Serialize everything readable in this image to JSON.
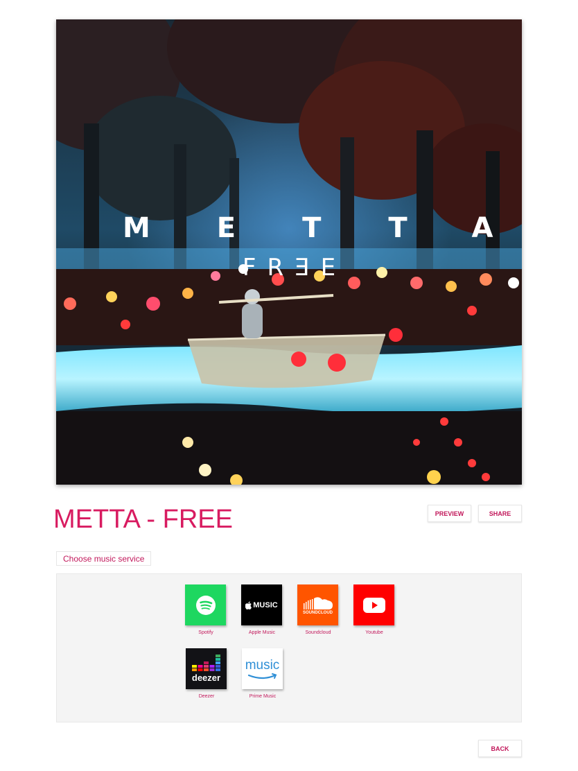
{
  "cover": {
    "artist_text": "METTA",
    "track_text": "FRƎE"
  },
  "track": {
    "title": "METTA - FREE"
  },
  "actions": {
    "preview_label": "PREVIEW",
    "share_label": "SHARE",
    "back_label": "BACK"
  },
  "services": {
    "heading": "Choose music service",
    "items": [
      {
        "name": "Spotify",
        "icon": "spotify-icon",
        "color": "#1ed760"
      },
      {
        "name": "Apple Music",
        "icon": "apple-music-icon",
        "color": "#000000",
        "tile_text": "MUSIC"
      },
      {
        "name": "Soundcloud",
        "icon": "soundcloud-icon",
        "color": "#ff5500",
        "tile_text": "SOUNDCLOUD"
      },
      {
        "name": "Youtube",
        "icon": "youtube-icon",
        "color": "#ff0000"
      },
      {
        "name": "Deezer",
        "icon": "deezer-icon",
        "color": "#121216",
        "tile_text": "deezer"
      },
      {
        "name": "Prime Music",
        "icon": "amazon-music-icon",
        "color": "#ffffff",
        "tile_text": "music"
      }
    ]
  },
  "theme": {
    "accent": "#d81b60",
    "panel_bg": "#f4f4f4"
  }
}
